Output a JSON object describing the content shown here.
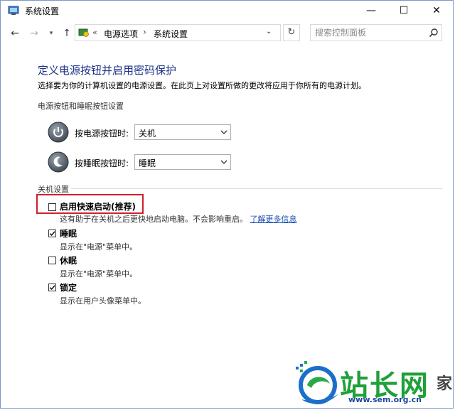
{
  "window": {
    "title": "系统设置",
    "minimize_glyph": "—",
    "maximize_glyph": "☐",
    "close_glyph": "✕"
  },
  "nav": {
    "back_glyph": "←",
    "forward_glyph": "→",
    "recent_glyph": "▾",
    "up_glyph": "↑",
    "address": {
      "overflow": "«",
      "crumbs": [
        "电源选项",
        "系统设置"
      ],
      "separator": "›",
      "dropdown_glyph": "⌄"
    },
    "refresh_glyph": "↻",
    "search_placeholder": "搜索控制面板"
  },
  "content": {
    "heading": "定义电源按钮并启用密码保护",
    "description": "选择要为你的计算机设置的电源设置。在此页上对设置所做的更改将应用于你所有的电源计划。",
    "power_section": {
      "label": "电源按钮和睡眠按钮设置",
      "rows": [
        {
          "label": "按电源按钮时:",
          "value": "关机",
          "icon": "power-button-icon"
        },
        {
          "label": "按睡眠按钮时:",
          "value": "睡眠",
          "icon": "sleep-button-icon"
        }
      ]
    },
    "shutdown_section": {
      "label": "关机设置",
      "options": [
        {
          "label": "启用快速启动(推荐)",
          "checked": false,
          "desc": "这有助于在关机之后更快地启动电脑。不会影响重启。",
          "link": "了解更多信息"
        },
        {
          "label": "睡眠",
          "checked": true,
          "desc": "显示在\"电源\"菜单中。"
        },
        {
          "label": "休眠",
          "checked": false,
          "desc": "显示在\"电源\"菜单中。"
        },
        {
          "label": "锁定",
          "checked": true,
          "desc": "显示在用户头像菜单中。"
        }
      ]
    }
  },
  "colors": {
    "heading": "#1e3287",
    "link": "#1a4fb0",
    "highlight_border": "#d0202a",
    "watermark_green": "#1fa03a",
    "watermark_blue": "#1c4aa0"
  },
  "watermark": {
    "brand": "站长网",
    "url": "www.sem.org.cn",
    "tail": "家"
  }
}
